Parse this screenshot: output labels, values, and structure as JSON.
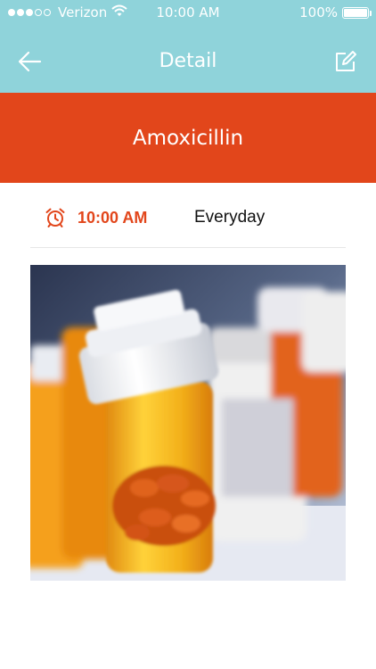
{
  "status_bar": {
    "carrier": "Verizon",
    "time": "10:00 AM",
    "battery": "100%",
    "battery_level": 1.0,
    "signal_dots": 3,
    "signal_total": 5
  },
  "nav": {
    "title": "Detail",
    "back_icon": "arrow-left-icon",
    "edit_icon": "edit-icon"
  },
  "medicine": {
    "name": "Amoxicillin"
  },
  "schedule": {
    "icon": "alarm-clock-icon",
    "time": "10:00 AM",
    "frequency": "Everyday"
  },
  "image": {
    "subject": "medicine-bottle-photo"
  },
  "colors": {
    "nav_bg": "#8fd3da",
    "accent": "#e2461b",
    "text_dark": "#111111"
  }
}
